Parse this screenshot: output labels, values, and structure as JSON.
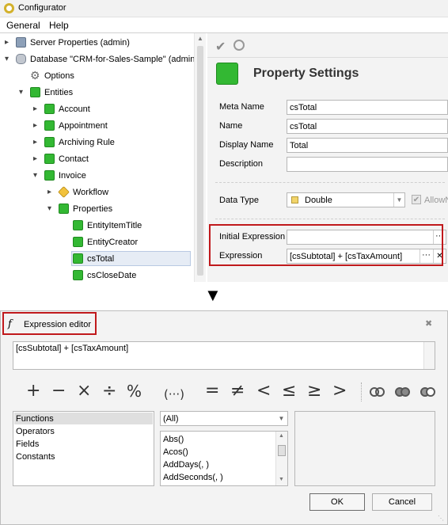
{
  "window": {
    "title": "Configurator"
  },
  "menu": {
    "general": "General",
    "help": "Help"
  },
  "tree": [
    {
      "label": "Server Properties (admin)"
    },
    {
      "label": "Database \"CRM-for-Sales-Sample\" (admin)"
    },
    {
      "label": "Options"
    },
    {
      "label": "Entities"
    },
    {
      "label": "Account"
    },
    {
      "label": "Appointment"
    },
    {
      "label": "Archiving Rule"
    },
    {
      "label": "Contact"
    },
    {
      "label": "Invoice"
    },
    {
      "label": "Workflow"
    },
    {
      "label": "Properties"
    },
    {
      "label": "EntityItemTitle"
    },
    {
      "label": "EntityCreator"
    },
    {
      "label": "csTotal"
    },
    {
      "label": "csCloseDate"
    }
  ],
  "panel": {
    "title": "Property Settings",
    "meta_name_label": "Meta Name",
    "meta_name": "csTotal",
    "name_label": "Name",
    "name": "csTotal",
    "display_name_label": "Display Name",
    "display_name": "Total",
    "description_label": "Description",
    "description": "",
    "data_type_label": "Data Type",
    "data_type": "Double",
    "allow_null_label": "AllowN",
    "initial_expression_label": "Initial Expression",
    "initial_expression": "",
    "expression_label": "Expression",
    "expression": "[csSubtotal] + [csTaxAmount]",
    "ellipsis": "···",
    "clear": "✕"
  },
  "down_arrow": "▼",
  "editor": {
    "title": "Expression editor",
    "expression": "[csSubtotal] + [csTaxAmount]",
    "operators": [
      "+",
      "−",
      "×",
      "÷",
      "%",
      "(···)",
      "=",
      "≠",
      "<",
      "≤",
      "≥",
      ">"
    ],
    "categories": [
      "Functions",
      "Operators",
      "Fields",
      "Constants"
    ],
    "filter": "(All)",
    "functions": [
      "Abs()",
      "Acos()",
      "AddDays(, )",
      "AddSeconds(, )"
    ],
    "ok": "OK",
    "cancel": "Cancel",
    "close": "✖"
  },
  "colors": {
    "accent_red": "#c0191c",
    "green_icon": "#33b833"
  }
}
